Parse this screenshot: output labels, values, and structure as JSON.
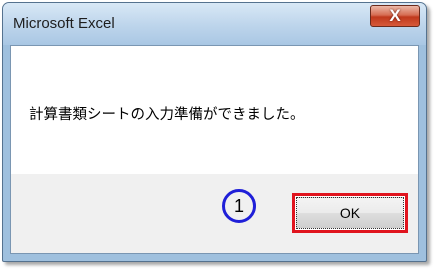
{
  "window": {
    "title": "Microsoft Excel",
    "close_label": "X"
  },
  "message": {
    "text": "計算書類シートの入力準備ができました。"
  },
  "buttons": {
    "ok_label": "OK"
  },
  "annotation": {
    "marker_label": "1",
    "highlight_color": "#e0141e",
    "marker_color": "#1f1fd8"
  }
}
